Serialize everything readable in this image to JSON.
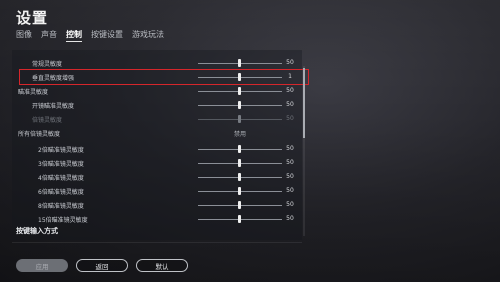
{
  "title": "设置",
  "tabs": [
    "图像",
    "声音",
    "控制",
    "按键设置",
    "游戏玩法"
  ],
  "active_tab": "控制",
  "rows": [
    {
      "label": "常规灵敏度",
      "value": "50",
      "level": 0.5
    },
    {
      "label": "垂直灵敏度增强",
      "value": "1",
      "level": 0.5
    },
    {
      "label": "瞄准灵敏度",
      "value": "50",
      "level": 0.5
    },
    {
      "label": "开镜瞄准灵敏度",
      "value": "50",
      "level": 0.5
    },
    {
      "label": "倍镜灵敏度",
      "value": "50",
      "level": 0.5
    },
    {
      "label": "所有倍镜灵敏度",
      "value": "禁用"
    },
    {
      "label": "2倍瞄准镜灵敏度",
      "value": "50",
      "level": 0.5
    },
    {
      "label": "3倍瞄准镜灵敏度",
      "value": "50",
      "level": 0.5
    },
    {
      "label": "4倍瞄准镜灵敏度",
      "value": "50",
      "level": 0.5
    },
    {
      "label": "6倍瞄准镜灵敏度",
      "value": "50",
      "level": 0.5
    },
    {
      "label": "8倍瞄准镜灵敏度",
      "value": "50",
      "level": 0.5
    },
    {
      "label": "15倍瞄准镜灵敏度",
      "value": "50",
      "level": 0.5
    }
  ],
  "section_title": "按键输入方式",
  "buttons": {
    "apply": "应用",
    "back": "返回",
    "default": "默认"
  },
  "colors": {
    "highlight": "#d5262b"
  }
}
